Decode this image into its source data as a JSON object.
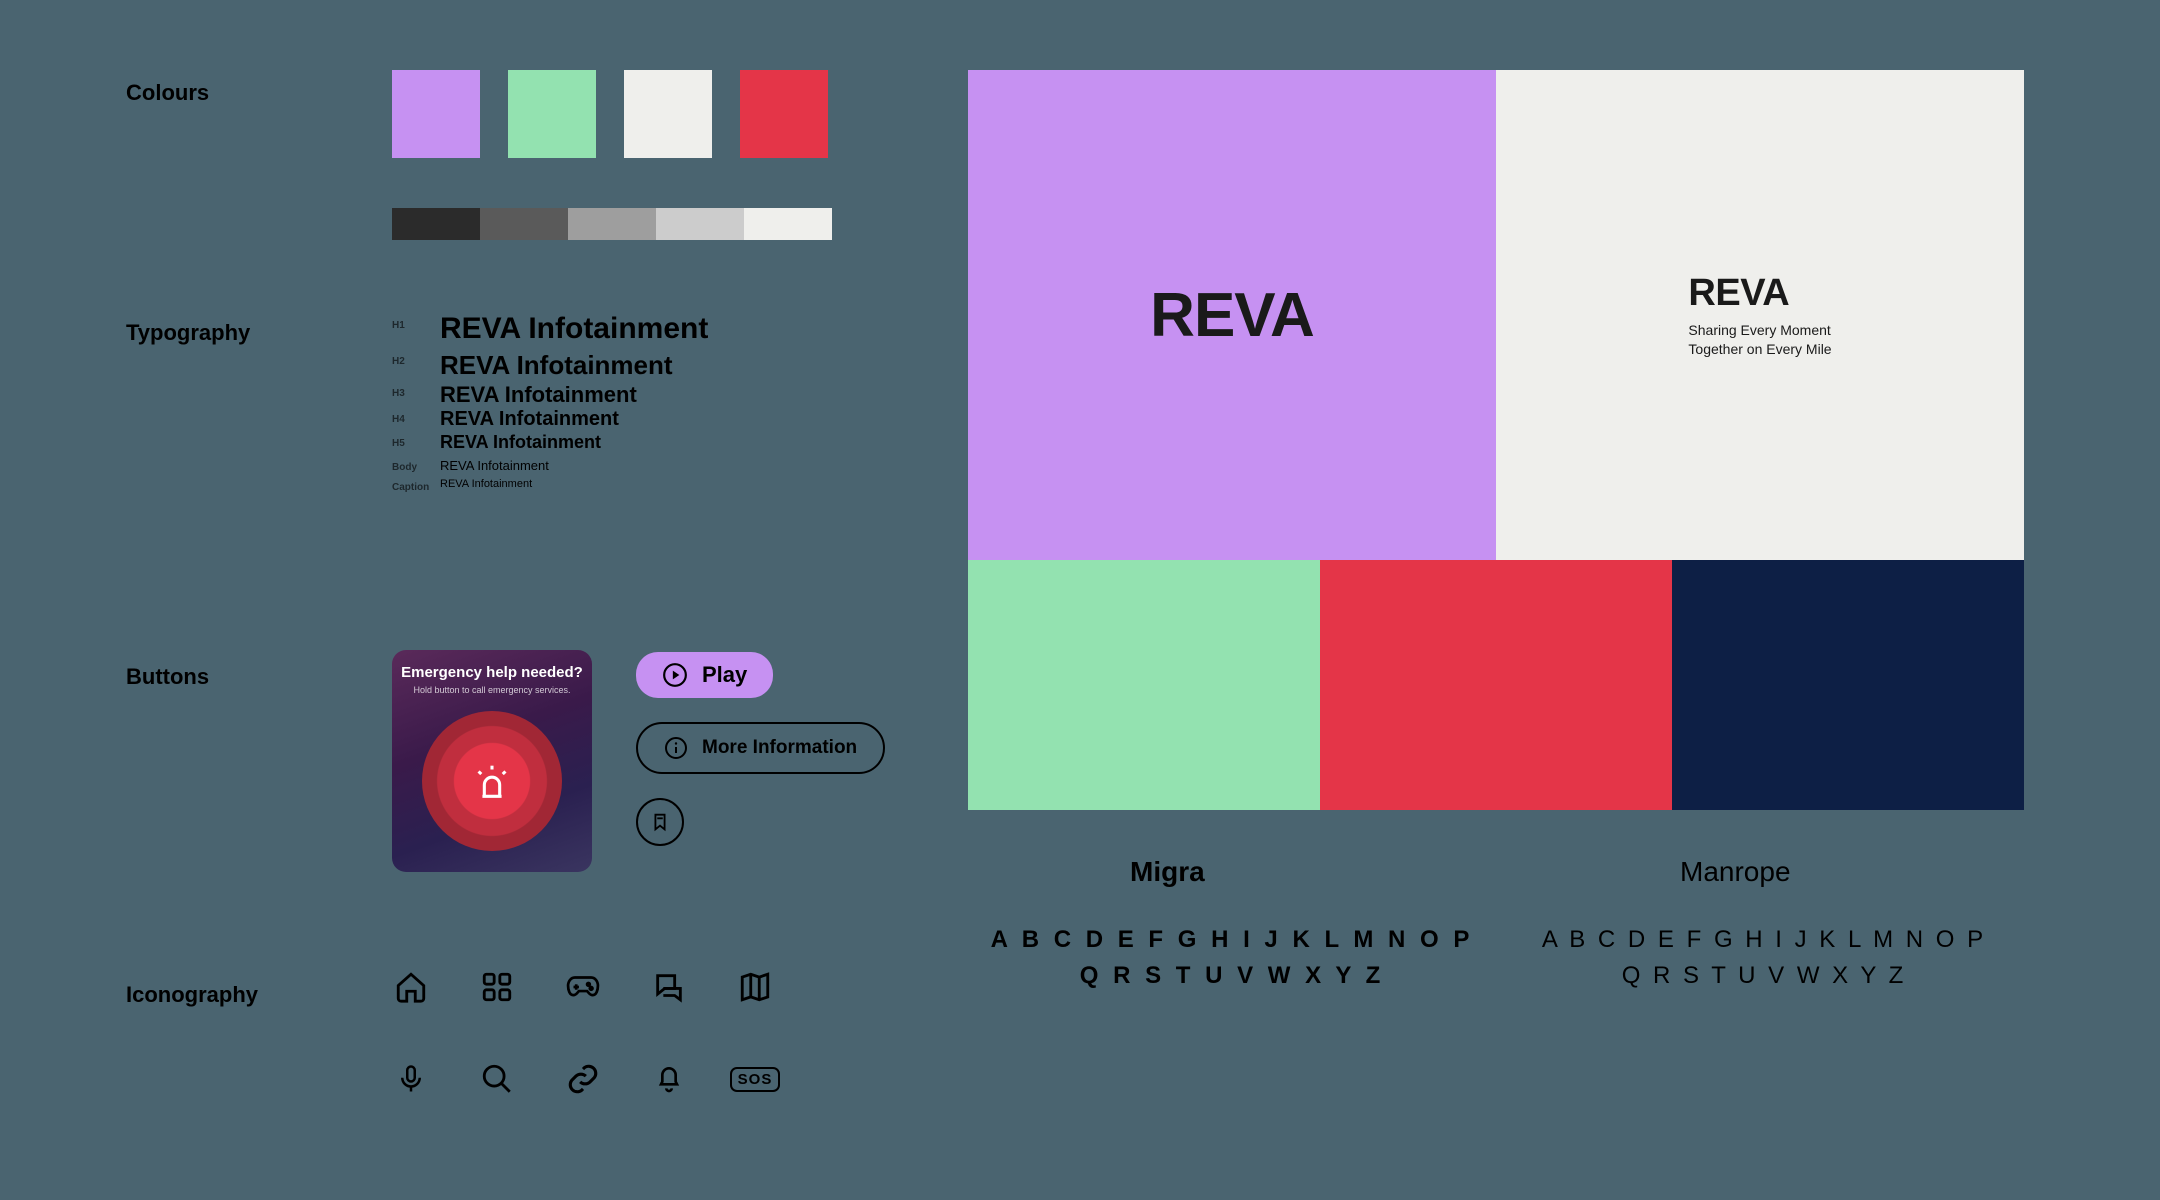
{
  "sections": {
    "colours": "Colours",
    "typography": "Typography",
    "buttons": "Buttons",
    "iconography": "Iconography"
  },
  "palette": {
    "primary": [
      "#c691f2",
      "#93e2b0",
      "#efefec",
      "#e43548"
    ],
    "greys": [
      "#2b2b2b",
      "#5a5a5a",
      "#9e9e9e",
      "#cccccc",
      "#efefec"
    ]
  },
  "typography": {
    "labels": [
      "H1",
      "H2",
      "H3",
      "H4",
      "H5",
      "Body",
      "Caption"
    ],
    "sample": "REVA Infotainment"
  },
  "buttons": {
    "emergency_title": "Emergency help needed?",
    "emergency_sub": "Hold button to call emergency services.",
    "play": "Play",
    "info": "More Information"
  },
  "iconography": {
    "row1": [
      "home",
      "grid",
      "gamepad",
      "chat",
      "map"
    ],
    "row2": [
      "mic",
      "search",
      "link",
      "bell",
      "sos"
    ],
    "sos_label": "SOS"
  },
  "brand": {
    "name": "REVA",
    "tagline1": "Sharing Every Moment",
    "tagline2": "Together on Every Mile",
    "tiles_top": [
      "#c691f2",
      "#efefec"
    ],
    "tiles_bot": [
      "#93e2b0",
      "#e43548",
      "#0d1f45"
    ]
  },
  "fonts": {
    "a_name": "Migra",
    "b_name": "Manrope",
    "alpha1": "A B C D E F G H I J K L M N O P",
    "alpha2": "Q R S T U V W X Y Z"
  }
}
